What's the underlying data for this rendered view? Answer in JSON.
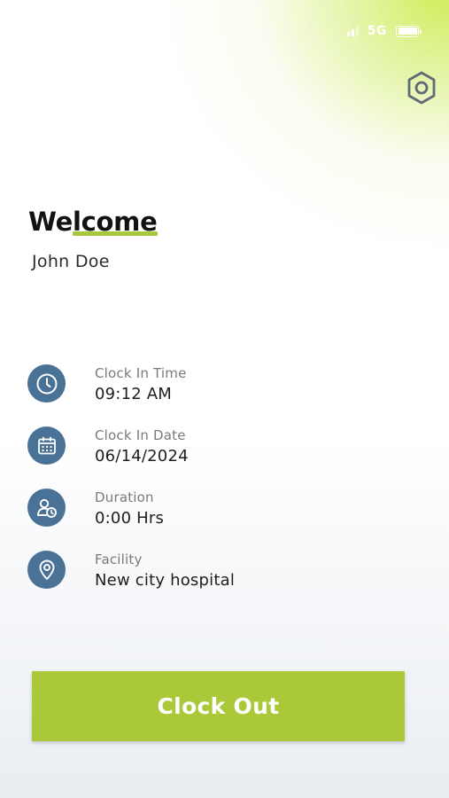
{
  "status_bar": {
    "network": "5G",
    "battery_level": 1.0,
    "signal_icon": "signal-icon",
    "battery_icon": "battery-icon"
  },
  "header": {
    "settings_icon": "hexagon-settings-icon"
  },
  "greeting": {
    "title": "Welcome",
    "user_name": "John Doe"
  },
  "info": {
    "items": [
      {
        "icon": "clock-icon",
        "label": "Clock In Time",
        "value": "09:12 AM"
      },
      {
        "icon": "calendar-icon",
        "label": "Clock In Date",
        "value": "06/14/2024"
      },
      {
        "icon": "user-clock-icon",
        "label": "Duration",
        "value": "0:00 Hrs"
      },
      {
        "icon": "location-pin-icon",
        "label": "Facility",
        "value": "New city hospital"
      }
    ]
  },
  "actions": {
    "clock_out_label": "Clock Out"
  },
  "colors": {
    "accent": "#a9c938",
    "icon_bg": "#4a7196",
    "gradient": "#cdec50"
  }
}
